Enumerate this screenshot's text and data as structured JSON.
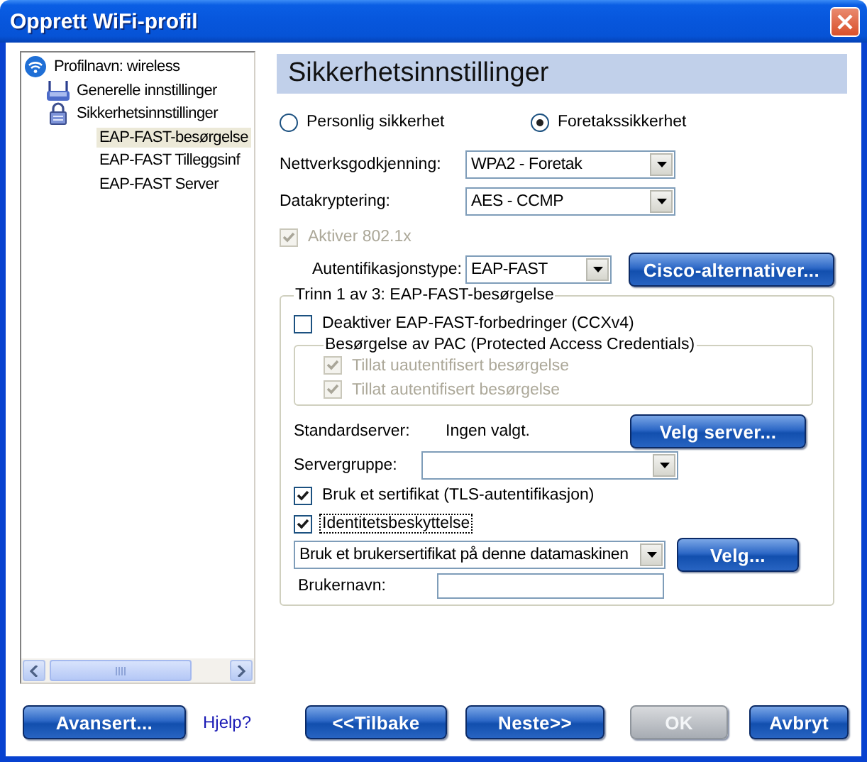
{
  "window": {
    "title": "Opprett WiFi-profil"
  },
  "tree": {
    "items": [
      {
        "label": "Profilnavn: wireless",
        "kind": "wifi",
        "selected": false,
        "children": [
          {
            "label": "Generelle innstillinger",
            "kind": "router",
            "selected": false
          },
          {
            "label": "Sikkerhetsinnstillinger",
            "kind": "lock",
            "selected": false,
            "children": [
              {
                "label": "EAP-FAST-besørgelse",
                "selected": true
              },
              {
                "label": "EAP-FAST Tilleggsinf",
                "selected": false
              },
              {
                "label": "EAP-FAST Server",
                "selected": false
              }
            ]
          }
        ]
      }
    ]
  },
  "security": {
    "heading": "Sikkerhetsinnstillinger",
    "modes": [
      {
        "label": "Personlig sikkerhet",
        "selected": false
      },
      {
        "label": "Foretakssikkerhet",
        "selected": true
      }
    ],
    "fields": [
      {
        "label": "Nettverksgodkjenning:",
        "value": "WPA2 - Foretak"
      },
      {
        "label": "Datakryptering:",
        "value": "AES - CCMP"
      }
    ],
    "enable_8021x": {
      "label": "Aktiver 802.1x",
      "checked": true,
      "disabled": true
    },
    "auth_type": {
      "label": "Autentifikasjonstype:",
      "value": "EAP-FAST"
    },
    "cisco_button": "Cisco-alternativer...",
    "step": {
      "title": "Trinn 1 av 3: EAP-FAST-besørgelse",
      "disable_enhancements": {
        "label": "Deaktiver EAP-FAST-forbedringer (CCXv4)",
        "checked": false,
        "disabled": false
      },
      "pac": {
        "title": "Besørgelse av PAC (Protected Access Credentials)",
        "options": [
          {
            "label": "Tillat uautentifisert besørgelse",
            "checked": true,
            "disabled": true
          },
          {
            "label": "Tillat autentifisert besørgelse",
            "checked": true,
            "disabled": true
          }
        ]
      },
      "default_server": {
        "label": "Standardserver:",
        "value": "Ingen valgt."
      },
      "select_server_button": "Velg server...",
      "server_group": {
        "label": "Servergruppe:"
      },
      "options": [
        {
          "label": "Bruk et sertifikat (TLS-autentifikasjon)",
          "checked": true,
          "focused": false
        },
        {
          "label": "Identitetsbeskyttelse",
          "checked": true,
          "focused": true
        }
      ],
      "certificate": {
        "value": "Bruk et brukersertifikat på denne datamaskinen"
      },
      "select_button": "Velg...",
      "username": {
        "label": "Brukernavn:"
      }
    }
  },
  "footer": [
    {
      "kind": "button",
      "label": "Avansert...",
      "disabled": false
    },
    {
      "kind": "link",
      "label": "Hjelp?"
    },
    {
      "kind": "button",
      "label": "<<Tilbake",
      "disabled": false
    },
    {
      "kind": "button",
      "label": "Neste>>",
      "disabled": false
    },
    {
      "kind": "button",
      "label": "OK",
      "disabled": true
    },
    {
      "kind": "button",
      "label": "Avbryt",
      "disabled": false
    }
  ]
}
